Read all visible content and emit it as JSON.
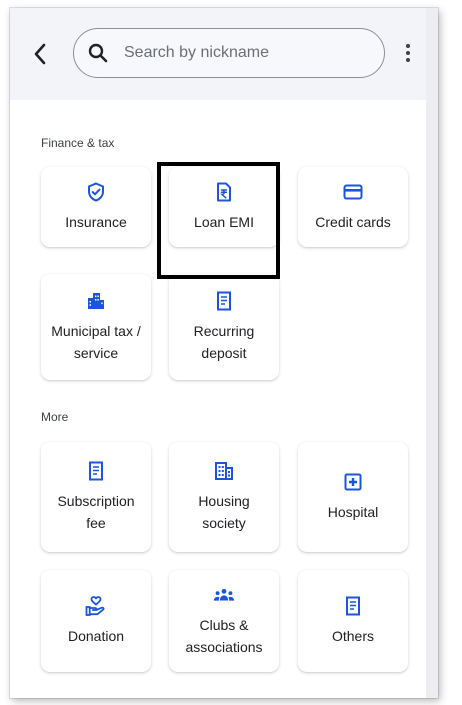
{
  "search": {
    "placeholder": "Search by nickname"
  },
  "sections": {
    "finance": {
      "title": "Finance & tax",
      "tiles": {
        "insurance": "Insurance",
        "loan_emi": "Loan EMI",
        "credit_cards": "Credit cards",
        "municipal_tax": "Municipal tax /\nservice",
        "recurring_deposit": "Recurring\ndeposit"
      }
    },
    "more": {
      "title": "More",
      "tiles": {
        "subscription_fee": "Subscription\nfee",
        "housing_society": "Housing\nsociety",
        "hospital": "Hospital",
        "donation": "Donation",
        "clubs": "Clubs &\nassociations",
        "others": "Others"
      }
    }
  },
  "icons": {
    "back": "arrow-back-icon",
    "search": "search-icon",
    "menu": "more-vert-icon",
    "insurance": "shield-check-icon",
    "loan_emi": "rupee-document-icon",
    "credit_cards": "credit-card-icon",
    "municipal_tax": "building-icon",
    "recurring_deposit": "receipt-icon",
    "subscription_fee": "receipt-icon",
    "housing_society": "apartment-icon",
    "hospital": "hospital-plus-icon",
    "donation": "heart-hand-icon",
    "clubs": "groups-icon",
    "others": "receipt-icon"
  },
  "colors": {
    "accent": "#1a56db",
    "header_bg": "#f2f4f9",
    "highlight_border": "#000000"
  }
}
